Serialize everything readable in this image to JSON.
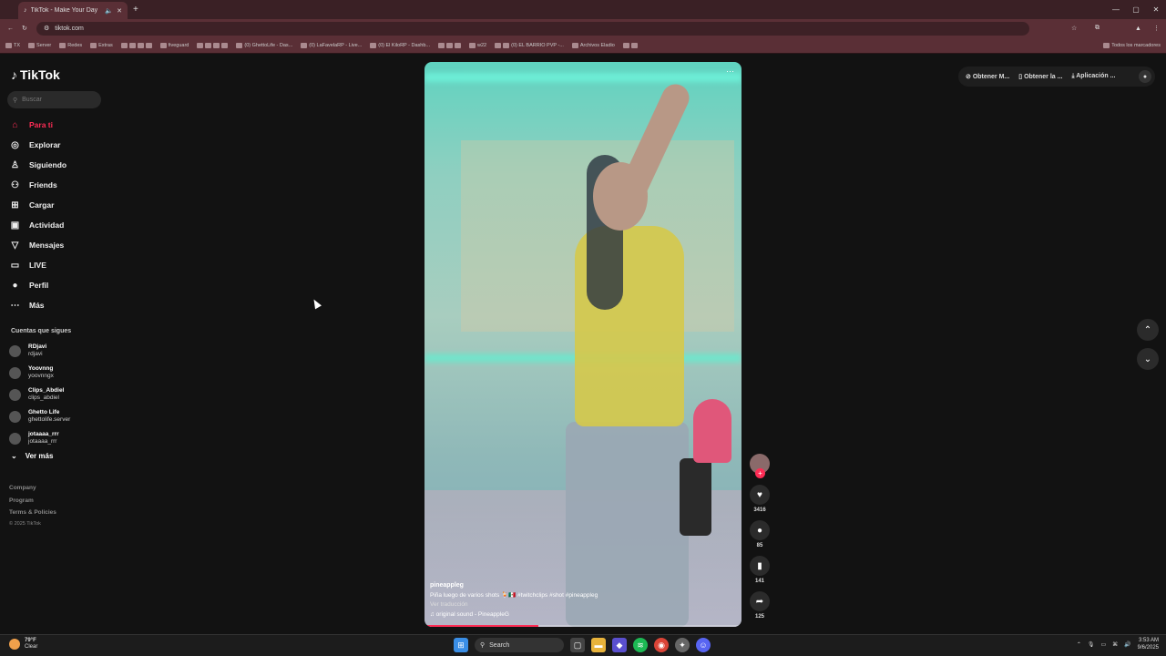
{
  "browser": {
    "tab_title": "TikTok - Make Your Day",
    "url": "tiktok.com",
    "bookmarks": [
      "TX",
      "Server",
      "Redes",
      "Extras",
      "fiveguard",
      "(0) GhettoLife - Das...",
      "(0) LaFavelaRP - Live...",
      "(0) El KiloRP - Dashb...",
      "w22",
      "(0) EL BARRIO PVP -...",
      "Archivos Eladio"
    ],
    "all_bookmarks": "Todos los marcadores"
  },
  "sidebar": {
    "logo": "TikTok",
    "search_placeholder": "Buscar",
    "nav": [
      {
        "label": "Para ti",
        "icon": "home-icon",
        "glyph": "⌂"
      },
      {
        "label": "Explorar",
        "icon": "compass-icon",
        "glyph": "◎"
      },
      {
        "label": "Siguiendo",
        "icon": "following-icon",
        "glyph": "♙"
      },
      {
        "label": "Friends",
        "icon": "friends-icon",
        "glyph": "⚇"
      },
      {
        "label": "Cargar",
        "icon": "upload-icon",
        "glyph": "⊞"
      },
      {
        "label": "Actividad",
        "icon": "activity-icon",
        "glyph": "▣"
      },
      {
        "label": "Mensajes",
        "icon": "messages-icon",
        "glyph": "▽"
      },
      {
        "label": "LIVE",
        "icon": "live-icon",
        "glyph": "▭"
      },
      {
        "label": "Perfil",
        "icon": "profile-icon",
        "glyph": "●"
      },
      {
        "label": "Más",
        "icon": "more-icon",
        "glyph": "⋯"
      }
    ],
    "following_title": "Cuentas que sigues",
    "following": [
      {
        "name": "RDjavi",
        "user": "rdjavi"
      },
      {
        "name": "Yoovnng",
        "user": "yoovnngx"
      },
      {
        "name": "Clips_Abdiel",
        "user": "clips_abdiel"
      },
      {
        "name": "Ghetto Life",
        "user": "ghettolife.server"
      },
      {
        "name": "jotaaaa_rrr",
        "user": "jotaaaa_rrr"
      }
    ],
    "see_more": "Ver más",
    "footer": [
      "Company",
      "Program",
      "Terms & Policies"
    ],
    "copyright": "© 2025 TikTok"
  },
  "video": {
    "author": "pineappleg",
    "caption": "Piña luego de varios shots 🍹🇲🇽 #twitchclips #shot #pineappleg",
    "translate": "Ver traducción",
    "sound": "♫ original sound - PineappleG",
    "progress": 0.36
  },
  "actions": {
    "likes": "3416",
    "comments": "85",
    "saves": "141",
    "shares": "125"
  },
  "top_right": {
    "get_m": "Obtener M...",
    "get_the": "Obtener la ...",
    "app": "Aplicación ..."
  },
  "taskbar": {
    "temp": "79°F",
    "condition": "Clear",
    "search": "Search",
    "time": "3:53 AM",
    "date": "9/6/2025"
  }
}
